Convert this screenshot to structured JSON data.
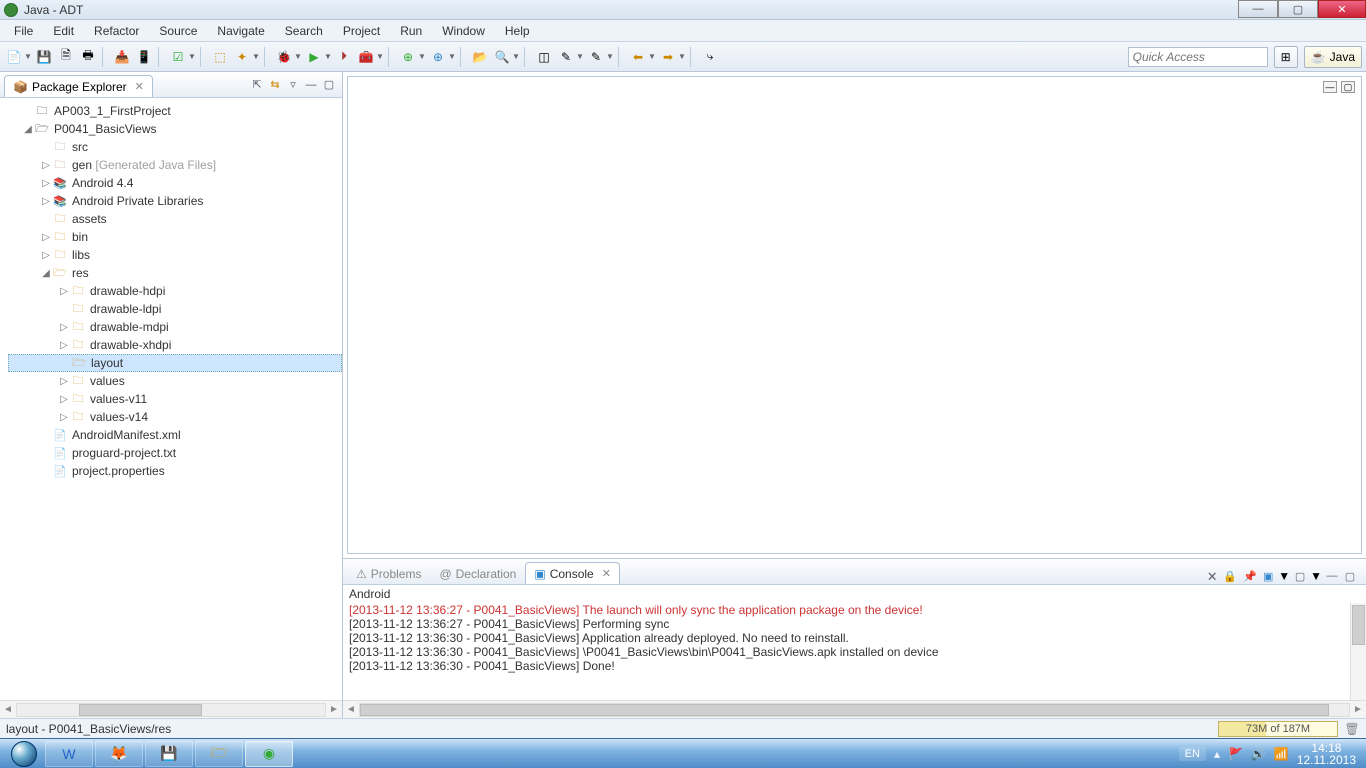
{
  "window": {
    "title": "Java - ADT"
  },
  "menu": [
    "File",
    "Edit",
    "Refactor",
    "Source",
    "Navigate",
    "Search",
    "Project",
    "Run",
    "Window",
    "Help"
  ],
  "quick_access_placeholder": "Quick Access",
  "perspective": {
    "java": "Java"
  },
  "package_explorer": {
    "title": "Package Explorer",
    "projects": [
      {
        "name": "AP003_1_FirstProject",
        "expanded": false
      },
      {
        "name": "P0041_BasicViews",
        "expanded": true
      }
    ],
    "p0041": {
      "src": "src",
      "gen": "gen",
      "gen_suffix": "[Generated Java Files]",
      "android": "Android 4.4",
      "priv_libs": "Android Private Libraries",
      "assets": "assets",
      "bin": "bin",
      "libs": "libs",
      "res": "res",
      "res_children": {
        "drawable_hdpi": "drawable-hdpi",
        "drawable_ldpi": "drawable-ldpi",
        "drawable_mdpi": "drawable-mdpi",
        "drawable_xhdpi": "drawable-xhdpi",
        "layout": "layout",
        "values": "values",
        "values_v11": "values-v11",
        "values_v14": "values-v14"
      },
      "manifest": "AndroidManifest.xml",
      "proguard": "proguard-project.txt",
      "props": "project.properties"
    }
  },
  "bottom_tabs": {
    "problems": "Problems",
    "declaration": "Declaration",
    "console": "Console"
  },
  "console": {
    "title": "Android",
    "lines": [
      {
        "cls": "cut",
        "text": "[2013-11-12 13:36:27 - P0041_BasicViews] The launch will only sync the application package on the device!"
      },
      {
        "cls": "line",
        "text": "[2013-11-12 13:36:27 - P0041_BasicViews] Performing sync"
      },
      {
        "cls": "line",
        "text": "[2013-11-12 13:36:30 - P0041_BasicViews] Application already deployed. No need to reinstall."
      },
      {
        "cls": "line",
        "text": "[2013-11-12 13:36:30 - P0041_BasicViews] \\P0041_BasicViews\\bin\\P0041_BasicViews.apk installed on device"
      },
      {
        "cls": "line",
        "text": "[2013-11-12 13:36:30 - P0041_BasicViews] Done!"
      }
    ]
  },
  "status": {
    "path": "layout - P0041_BasicViews/res",
    "heap": "73M of 187M"
  },
  "systray": {
    "lang": "EN",
    "time": "14:18",
    "date": "12.11.2013"
  }
}
